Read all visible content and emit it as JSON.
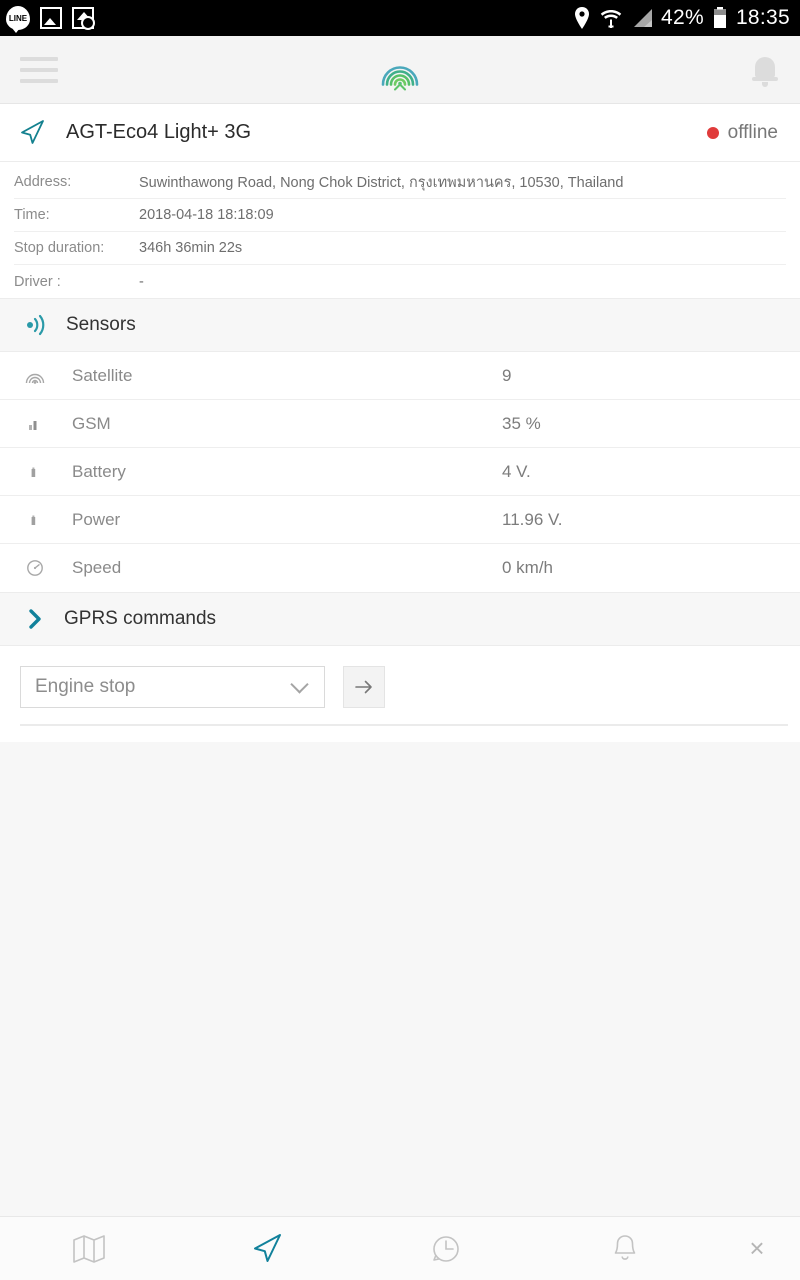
{
  "statusbar": {
    "left_icons": [
      "line-icon",
      "photo-icon",
      "screenshot-icon"
    ],
    "location_icon": "location-pin-icon",
    "wifi_icon": "wifi-icon",
    "signal_icon": "cellular-signal-icon",
    "battery_percent": "42%",
    "battery_icon": "battery-icon",
    "clock": "18:35"
  },
  "header": {
    "menu_icon": "hamburger-menu-icon",
    "logo_icon": "radar-logo-icon",
    "notifications_icon": "bell-icon"
  },
  "device": {
    "marker_icon": "navigation-arrow-icon",
    "name": "AGT-Eco4 Light+ 3G",
    "status": "offline",
    "status_color": "#e03b3b"
  },
  "details": [
    {
      "label": "Address:",
      "value": "Suwinthawong Road, Nong Chok District, กรุงเทพมหานคร, 10530, Thailand"
    },
    {
      "label": "Time:",
      "value": "2018-04-18 18:18:09"
    },
    {
      "label": "Stop duration:",
      "value": "346h 36min 22s"
    },
    {
      "label": "Driver :",
      "value": "-"
    }
  ],
  "sensors": {
    "title": "Sensors",
    "icon": "broadcast-icon",
    "rows": [
      {
        "icon": "satellite-icon",
        "name": "Satellite",
        "value": "9"
      },
      {
        "icon": "gsm-signal-icon",
        "name": "GSM",
        "value": "35 %"
      },
      {
        "icon": "battery-sensor-icon",
        "name": "Battery",
        "value": "4 V."
      },
      {
        "icon": "power-sensor-icon",
        "name": "Power",
        "value": "11.96 V."
      },
      {
        "icon": "speedometer-icon",
        "name": "Speed",
        "value": "0 km/h"
      }
    ]
  },
  "gprs": {
    "title": "GPRS commands",
    "icon": "chevron-right-icon",
    "selected_command": "Engine stop",
    "command_options": [
      "Engine stop"
    ],
    "dropdown_icon": "chevron-down-icon",
    "send_icon": "arrow-right-icon"
  },
  "bottom_nav": [
    {
      "icon": "map-icon",
      "active": false
    },
    {
      "icon": "navigation-arrow-icon",
      "active": true
    },
    {
      "icon": "history-clock-icon",
      "active": false
    },
    {
      "icon": "bell-icon",
      "active": false
    }
  ],
  "bottom_close": "×",
  "colors": {
    "accent": "#11819b",
    "logo_teal": "#3aa8a0",
    "logo_green": "#5dc46a",
    "offline": "#e03b3b"
  }
}
